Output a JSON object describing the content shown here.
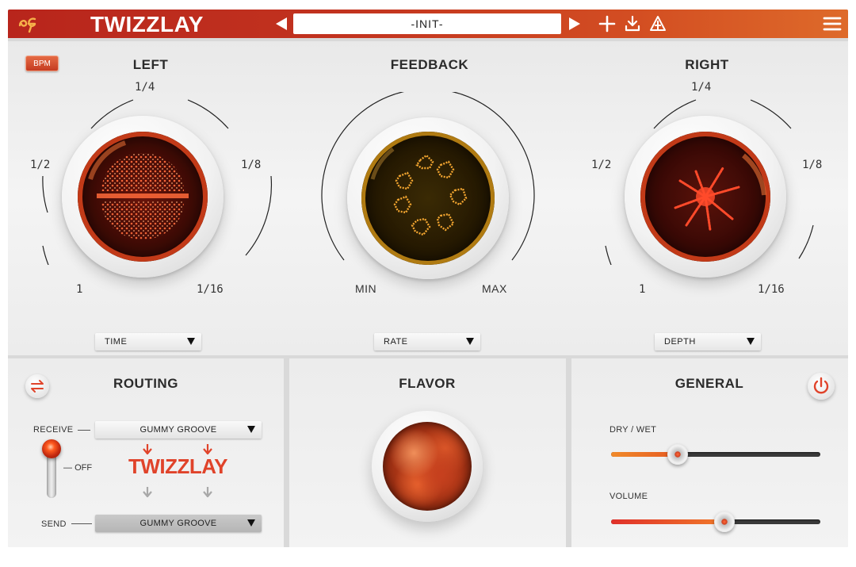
{
  "header": {
    "logo_icon": "ec-logo-icon",
    "title": "TWIZZLAY",
    "preset_name": "-INIT-",
    "icons": [
      "prev-preset-icon",
      "next-preset-icon",
      "add-icon",
      "download-icon",
      "randomize-icon",
      "menu-icon"
    ],
    "gradient_colors": [
      "#b8251c",
      "#de6a2a"
    ]
  },
  "top": {
    "bpm_label": "BPM",
    "left": {
      "title": "LEFT",
      "ticks": {
        "top": "1/4",
        "left": "1/2",
        "right": "1/8",
        "bottom_left": "1",
        "bottom_right": "1/16"
      },
      "dropdown": "TIME"
    },
    "feedback": {
      "title": "FEEDBACK",
      "min_label": "MIN",
      "max_label": "MAX",
      "dropdown": "RATE"
    },
    "right": {
      "title": "RIGHT",
      "ticks": {
        "top": "1/4",
        "left": "1/2",
        "right": "1/8",
        "bottom_left": "1",
        "bottom_right": "1/16"
      },
      "dropdown": "DEPTH"
    }
  },
  "routing": {
    "title": "ROUTING",
    "receive_label": "RECEIVE",
    "receive_value": "GUMMY GROOVE",
    "plugin_name": "TWIZZLAY",
    "toggle_label": "OFF",
    "send_label": "SEND",
    "send_value": "GUMMY GROOVE"
  },
  "flavor": {
    "title": "FLAVOR"
  },
  "general": {
    "title": "GENERAL",
    "dry_wet_label": "DRY / WET",
    "dry_wet_value": 0.32,
    "volume_label": "VOLUME",
    "volume_value": 0.54,
    "accent_color": "#e0432a"
  }
}
